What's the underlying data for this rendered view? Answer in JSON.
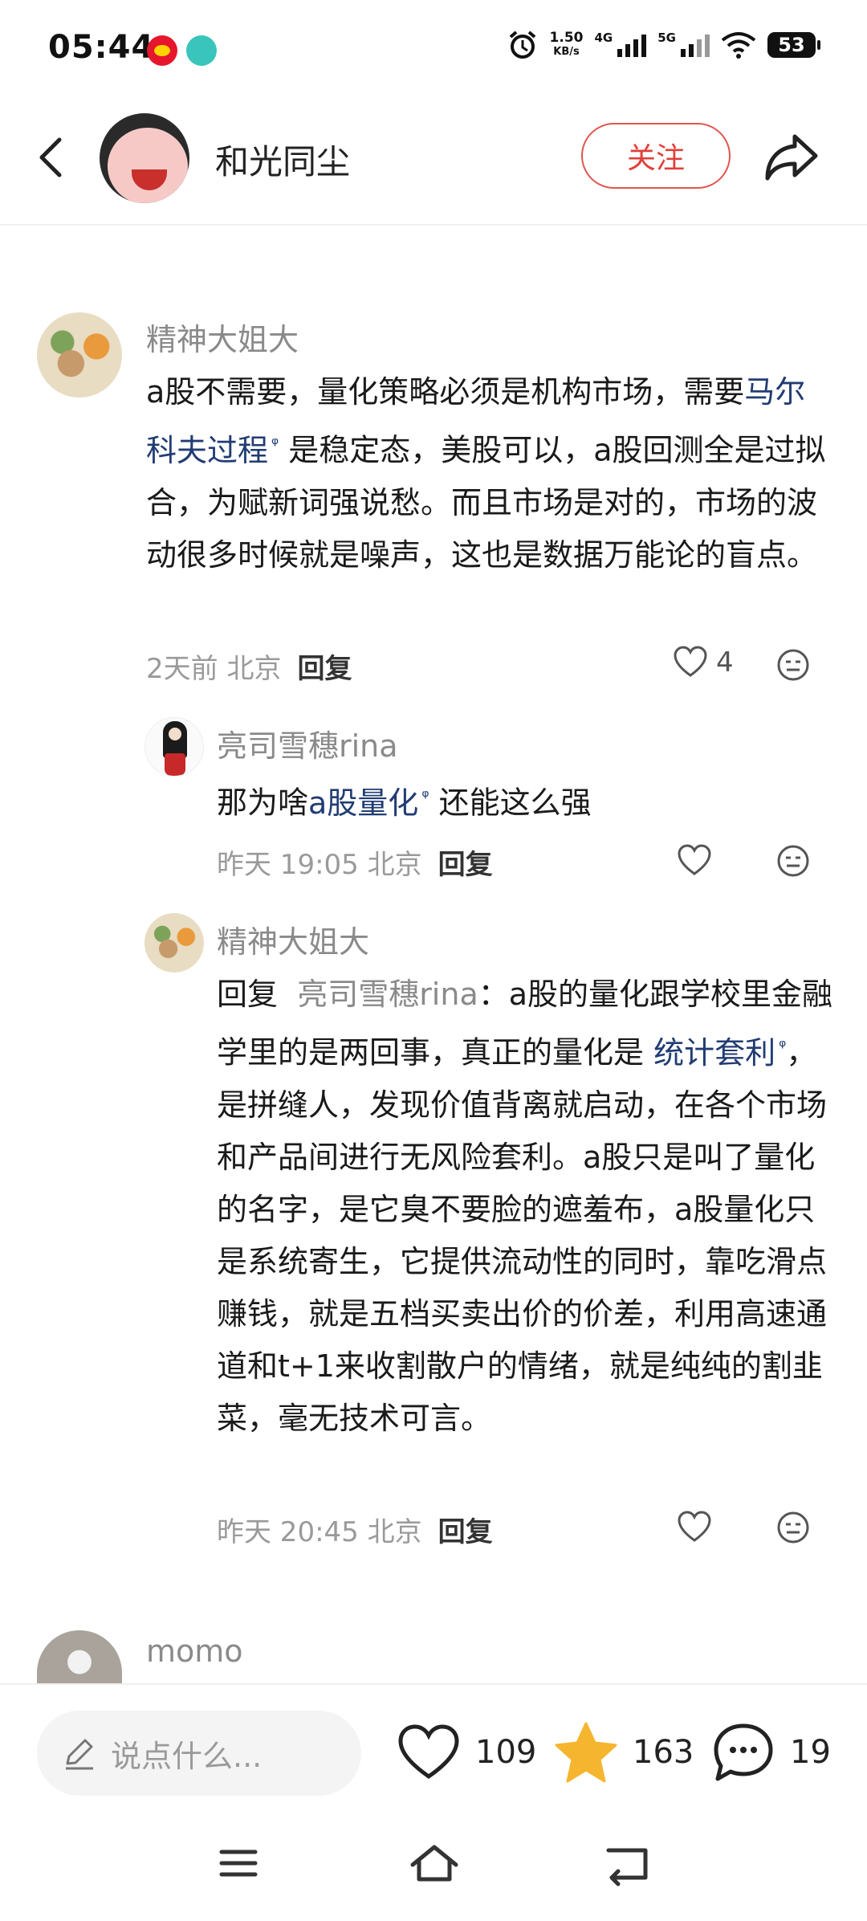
{
  "status_bar": {
    "time": "05:44",
    "net_speed_value": "1.50",
    "net_speed_unit": "KB/s",
    "sig1": "4G",
    "sig2": "5G",
    "battery": "53"
  },
  "header": {
    "name": "和光同尘",
    "follow_label": "关注"
  },
  "comments": [
    {
      "user": "精神大姐大",
      "text_1": "a股不需要，量化策略必须是机构市场，需要",
      "link": "马尔科夫过程",
      "text_2": "是稳定态，美股可以，a股回测全是过拟合，为赋新词强说愁。而且市场是对的，市场的波动很多时候就是噪声，这也是数据万能论的盲点。",
      "meta": "2天前 北京",
      "reply_label": "回复",
      "likes": "4"
    },
    {
      "user": "亮司雪穗rina",
      "text_1": "那为啥",
      "link": "a股量化",
      "text_2": "还能这么强",
      "meta": "昨天 19:05 北京",
      "reply_label": "回复"
    },
    {
      "user": "精神大姐大",
      "reply_prefix": "回复",
      "mention": "亮司雪穗rina",
      "text_1": "：a股的量化跟学校里金融学里的是两回事，真正的量化是",
      "link": "统计套利",
      "text_2": "，是拼缝人，发现价值背离就启动，在各个市场和产品间进行无风险套利。a股只是叫了量化的名字，是它臭不要脸的遮羞布，a股量化只是系统寄生，它提供流动性的同时，靠吃滑点赚钱，就是五档买卖出价的价差，利用高速通道和t+1来收割散户的情绪，就是纯纯的割韭菜，毫无技术可言。",
      "meta": "昨天 20:45 北京",
      "reply_label": "回复"
    },
    {
      "user": "momo"
    }
  ],
  "bottom_bar": {
    "input_placeholder": "说点什么...",
    "likes": "109",
    "favorites": "163",
    "comments": "19",
    "star_color": "#f5b52e"
  },
  "icons": {
    "search_mark": "ᵠ"
  }
}
